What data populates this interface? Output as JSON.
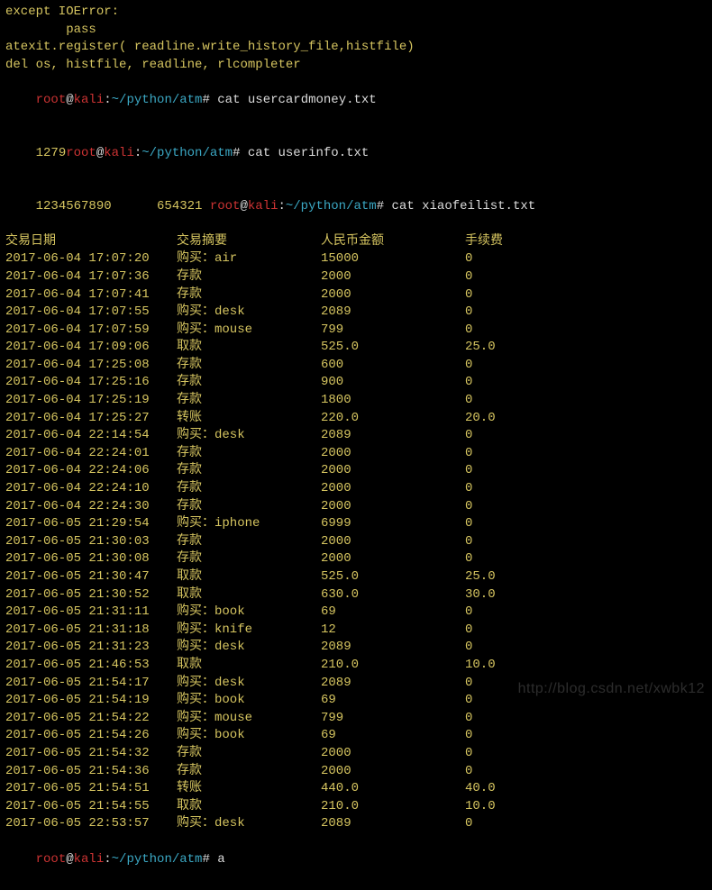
{
  "code": {
    "except": "except IOError:",
    "pass": "        pass",
    "atexit": "atexit.register( readline.write_history_file,histfile)",
    "blank": "",
    "del": "del os, histfile, readline, rlcompleter"
  },
  "prompts": {
    "user": "root",
    "at": "@",
    "host": "kali",
    "colon": ":",
    "path": "~/python/atm",
    "hash": "# ",
    "cmd1": "cat usercardmoney.txt",
    "out1": "1279",
    "cmd2": "cat userinfo.txt",
    "out2a": "1234567890",
    "out2b": "      654321 ",
    "cmd3": "cat xiaofeilist.txt",
    "cmd4": "a"
  },
  "header": {
    "c1": "交易日期",
    "c2": "交易摘要",
    "c3": "人民币金额",
    "c4": "手续费"
  },
  "rows": [
    {
      "date": "2017-06-04 17:07:20",
      "summary": "购买：air",
      "amount": "15000",
      "fee": "0"
    },
    {
      "date": "2017-06-04 17:07:36",
      "summary": "存款",
      "amount": "2000",
      "fee": "0"
    },
    {
      "date": "2017-06-04 17:07:41",
      "summary": "存款",
      "amount": "2000",
      "fee": "0"
    },
    {
      "date": "2017-06-04 17:07:55",
      "summary": "购买：desk",
      "amount": "2089",
      "fee": "0"
    },
    {
      "date": "2017-06-04 17:07:59",
      "summary": "购买：mouse",
      "amount": "799",
      "fee": "0"
    },
    {
      "date": "2017-06-04 17:09:06",
      "summary": "取款",
      "amount": "525.0",
      "fee": "25.0"
    },
    {
      "date": "2017-06-04 17:25:08",
      "summary": "存款",
      "amount": "600",
      "fee": "0"
    },
    {
      "date": "2017-06-04 17:25:16",
      "summary": "存款",
      "amount": "900",
      "fee": "0"
    },
    {
      "date": "2017-06-04 17:25:19",
      "summary": "存款",
      "amount": "1800",
      "fee": "0"
    },
    {
      "date": "2017-06-04 17:25:27",
      "summary": "转账",
      "amount": "220.0",
      "fee": "20.0"
    },
    {
      "date": "2017-06-04 22:14:54",
      "summary": "购买：desk",
      "amount": "2089",
      "fee": "0"
    },
    {
      "date": "2017-06-04 22:24:01",
      "summary": "存款",
      "amount": "2000",
      "fee": "0"
    },
    {
      "date": "2017-06-04 22:24:06",
      "summary": "存款",
      "amount": "2000",
      "fee": "0"
    },
    {
      "date": "2017-06-04 22:24:10",
      "summary": "存款",
      "amount": "2000",
      "fee": "0"
    },
    {
      "date": "2017-06-04 22:24:30",
      "summary": "存款",
      "amount": "2000",
      "fee": "0"
    },
    {
      "date": "2017-06-05 21:29:54",
      "summary": "购买：iphone",
      "amount": "6999",
      "fee": "0"
    },
    {
      "date": "2017-06-05 21:30:03",
      "summary": "存款",
      "amount": "2000",
      "fee": "0"
    },
    {
      "date": "2017-06-05 21:30:08",
      "summary": "存款",
      "amount": "2000",
      "fee": "0"
    },
    {
      "date": "2017-06-05 21:30:47",
      "summary": "取款",
      "amount": "525.0",
      "fee": "25.0"
    },
    {
      "date": "2017-06-05 21:30:52",
      "summary": "取款",
      "amount": "630.0",
      "fee": "30.0"
    },
    {
      "date": "2017-06-05 21:31:11",
      "summary": "购买：book",
      "amount": "69",
      "fee": "0"
    },
    {
      "date": "2017-06-05 21:31:18",
      "summary": "购买：knife",
      "amount": "12",
      "fee": "0"
    },
    {
      "date": "2017-06-05 21:31:23",
      "summary": "购买：desk",
      "amount": "2089",
      "fee": "0"
    },
    {
      "date": "2017-06-05 21:46:53",
      "summary": "取款",
      "amount": "210.0",
      "fee": "10.0"
    },
    {
      "date": "2017-06-05 21:54:17",
      "summary": "购买：desk",
      "amount": "2089",
      "fee": "0"
    },
    {
      "date": "2017-06-05 21:54:19",
      "summary": "购买：book",
      "amount": "69",
      "fee": "0"
    },
    {
      "date": "2017-06-05 21:54:22",
      "summary": "购买：mouse",
      "amount": "799",
      "fee": "0"
    },
    {
      "date": "2017-06-05 21:54:26",
      "summary": "购买：book",
      "amount": "69",
      "fee": "0"
    },
    {
      "date": "2017-06-05 21:54:32",
      "summary": "存款",
      "amount": "2000",
      "fee": "0"
    },
    {
      "date": "2017-06-05 21:54:36",
      "summary": "存款",
      "amount": "2000",
      "fee": "0"
    },
    {
      "date": "2017-06-05 21:54:51",
      "summary": "转账",
      "amount": "440.0",
      "fee": "40.0"
    },
    {
      "date": "2017-06-05 21:54:55",
      "summary": "取款",
      "amount": "210.0",
      "fee": "10.0"
    },
    {
      "date": "2017-06-05 22:53:57",
      "summary": "购买：desk",
      "amount": "2089",
      "fee": "0"
    }
  ],
  "watermark": "http://blog.csdn.net/xwbk12"
}
